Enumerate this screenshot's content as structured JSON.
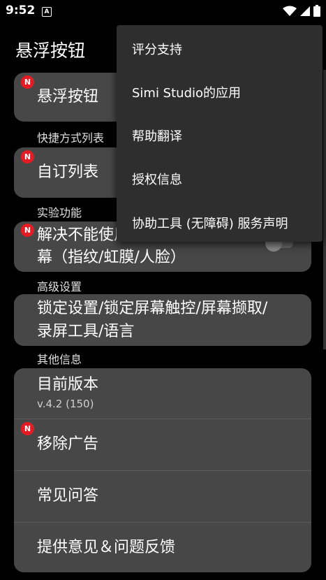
{
  "status_bar": {
    "time": "9:52",
    "notification_letter": "A",
    "icons": [
      "wifi-icon",
      "signal-icon",
      "battery-icon"
    ]
  },
  "app_bar": {
    "title": "悬浮按钮"
  },
  "badge_label": "N",
  "cards": {
    "floating_button": {
      "label": "悬浮按钮",
      "badge": true
    },
    "custom_list": {
      "label": "自订列表",
      "badge": true
    },
    "experimental": {
      "label_line1": "解决不能使用指纹解锁屏幕",
      "label_line2": "幕（指纹/虹膜/人脸）",
      "badge": true,
      "toggle_on": false
    },
    "advanced": {
      "label_line1": "锁定设置/锁定屏幕触控/屏幕撷取/",
      "label_line2": "录屏工具/语言"
    }
  },
  "sections": {
    "shortcut_list": "快捷方式列表",
    "experimental": "实验功能",
    "advanced": "高级设置",
    "other_info": "其他信息"
  },
  "info_items": {
    "version_title": "目前版本",
    "version_value": "v.4.2 (150)",
    "remove_ads": "移除广告",
    "faq": "常见问答",
    "feedback": "提供意见＆问题反馈"
  },
  "menu": {
    "items": [
      "评分支持",
      "Simi Studio的应用",
      "帮助翻译",
      "授权信息",
      "协助工具 (无障碍) 服务声明"
    ]
  },
  "colors": {
    "background": "#000000",
    "card": "#474747",
    "menu": "#2e2e2e",
    "badge": "#e51c23"
  }
}
